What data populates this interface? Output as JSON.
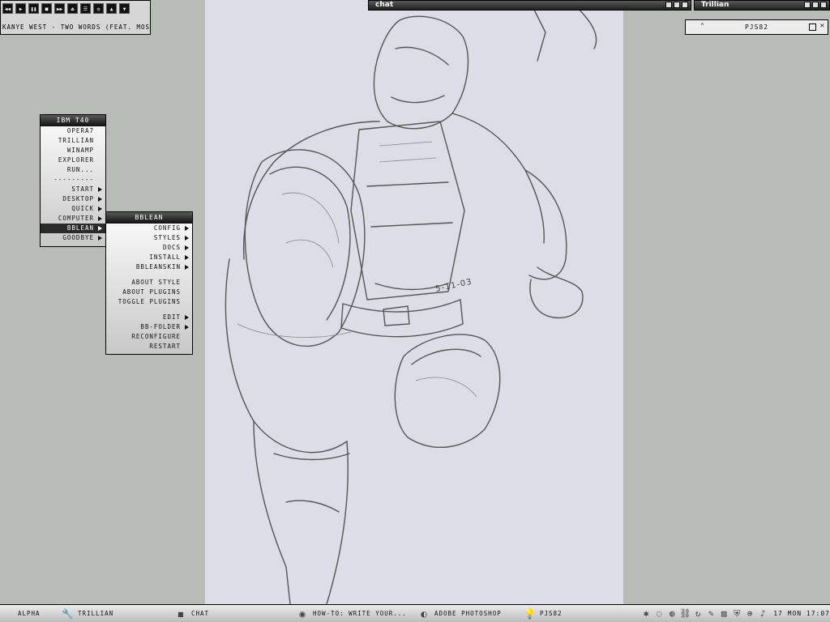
{
  "winamp": {
    "controls": [
      {
        "name": "prev-icon",
        "glyph": "◀◀"
      },
      {
        "name": "play-icon",
        "glyph": "▶"
      },
      {
        "name": "pause-icon",
        "glyph": "❚❚"
      },
      {
        "name": "stop-icon",
        "glyph": "■"
      },
      {
        "name": "next-icon",
        "glyph": "▶▶"
      },
      {
        "name": "eject-icon",
        "glyph": "⏏"
      },
      {
        "name": "playlist-icon",
        "glyph": "☰"
      },
      {
        "name": "options-icon",
        "glyph": "◎"
      },
      {
        "name": "volume-up-icon",
        "glyph": "▲"
      },
      {
        "name": "volume-down-icon",
        "glyph": "▼"
      }
    ],
    "track": "Kanye West - Two Words (Feat. Mos"
  },
  "windows": {
    "chat_title": "chat",
    "trillian_title": "Trillian",
    "pjs_label": "PJS82"
  },
  "menu_main": {
    "title": "IBM T40",
    "items": [
      {
        "label": "OPERA7",
        "sub": false
      },
      {
        "label": "TRILLIAN",
        "sub": false
      },
      {
        "label": "WINAMP",
        "sub": false
      },
      {
        "label": "EXPLORER",
        "sub": false
      },
      {
        "label": "RUN...",
        "sub": false
      },
      {
        "label": "---------",
        "sub": false
      },
      {
        "label": "START",
        "sub": true
      },
      {
        "label": "DESKTOP",
        "sub": true
      },
      {
        "label": "QUICK",
        "sub": true
      },
      {
        "label": "COMPUTER",
        "sub": true
      },
      {
        "label": "BBLEAN",
        "sub": true,
        "active": true
      },
      {
        "label": "GOODBYE",
        "sub": true
      }
    ]
  },
  "menu_bblean": {
    "title": "BBLEAN",
    "groups": [
      [
        {
          "label": "CONFIG",
          "sub": true
        },
        {
          "label": "STYLES",
          "sub": true
        },
        {
          "label": "DOCS",
          "sub": true
        },
        {
          "label": "INSTALL",
          "sub": true
        },
        {
          "label": "BBLEANSKIN",
          "sub": true
        }
      ],
      [
        {
          "label": "ABOUT STYLE",
          "sub": false
        },
        {
          "label": "ABOUT PLUGINS",
          "sub": false
        },
        {
          "label": "TOGGLE PLUGINS",
          "sub": false
        }
      ],
      [
        {
          "label": "EDIT",
          "sub": true
        },
        {
          "label": "BB-FOLDER",
          "sub": true
        },
        {
          "label": "RECONFIGURE",
          "sub": false
        },
        {
          "label": "RESTART",
          "sub": false
        }
      ]
    ]
  },
  "wallpaper": {
    "date_note": "5-11-03"
  },
  "taskbar": {
    "workspace": "ALPHA",
    "tasks": [
      {
        "icon": "wrench-icon",
        "glyph": "🔧",
        "label": "TRILLIAN"
      },
      {
        "icon": "cube-icon",
        "glyph": "◼",
        "label": "CHAT"
      },
      {
        "icon": "browser-icon",
        "glyph": "◉",
        "label": "HOW-TO: WRITE YOUR..."
      },
      {
        "icon": "photoshop-icon",
        "glyph": "◐",
        "label": "ADOBE PHOTOSHOP"
      },
      {
        "icon": "bulb-icon",
        "glyph": "💡",
        "label": "PJS82"
      }
    ],
    "tray": [
      {
        "name": "tray-figure-icon",
        "glyph": "✱"
      },
      {
        "name": "tray-bulb-icon",
        "glyph": "◌"
      },
      {
        "name": "tray-globe-icon",
        "glyph": "◍"
      },
      {
        "name": "tray-link-icon",
        "glyph": "⛓"
      },
      {
        "name": "tray-refresh-icon",
        "glyph": "↻"
      },
      {
        "name": "tray-pen-icon",
        "glyph": "✎"
      },
      {
        "name": "tray-chart-icon",
        "glyph": "▨"
      },
      {
        "name": "tray-shield-icon",
        "glyph": "⛨"
      },
      {
        "name": "tray-network-icon",
        "glyph": "⊕"
      },
      {
        "name": "tray-speaker-icon",
        "glyph": "♪"
      }
    ],
    "clock": "17 MON 17:07"
  }
}
